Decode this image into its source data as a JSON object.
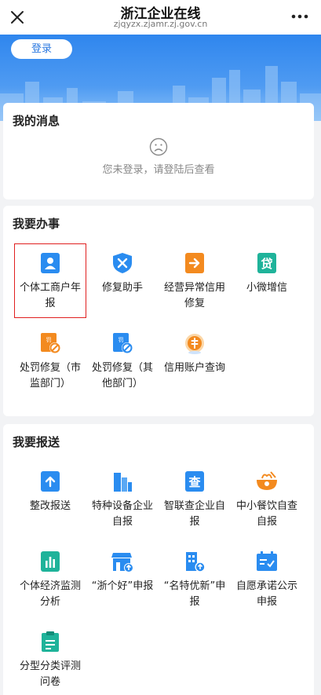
{
  "header": {
    "title": "浙江企业在线",
    "url": "zjqyzx.zjamr.zj.gov.cn"
  },
  "banner": {
    "login_label": "登录"
  },
  "messages": {
    "title": "我的消息",
    "empty_text": "您未登录，请登陆后查看"
  },
  "services": {
    "title": "我要办事",
    "items": [
      {
        "label": "个体工商户年报",
        "icon": "id-card-icon",
        "highlighted": true
      },
      {
        "label": "修复助手",
        "icon": "repair-shield-icon"
      },
      {
        "label": "经营异常信用修复",
        "icon": "arrow-doc-icon"
      },
      {
        "label": "小微增信",
        "icon": "loan-icon"
      },
      {
        "label": "处罚修复（市监部门）",
        "icon": "penalty-icon"
      },
      {
        "label": "处罚修复（其他部门）",
        "icon": "penalty-other-icon"
      },
      {
        "label": "信用账户查询",
        "icon": "coin-icon"
      }
    ]
  },
  "reports": {
    "title": "我要报送",
    "items": [
      {
        "label": "整改报送",
        "icon": "upload-doc-icon"
      },
      {
        "label": "特种设备企业自报",
        "icon": "building-icon"
      },
      {
        "label": "智联查企业自报",
        "icon": "search-doc-icon"
      },
      {
        "label": "中小餐饮自查自报",
        "icon": "food-bowl-icon"
      },
      {
        "label": "个体经济监测分析",
        "icon": "bar-chart-icon"
      },
      {
        "label": "“浙个好”申报",
        "icon": "shop-upload-icon"
      },
      {
        "label": "“名特优新”申报",
        "icon": "building-upload-icon"
      },
      {
        "label": "自愿承诺公示申报",
        "icon": "check-board-icon"
      },
      {
        "label": "分型分类评测问卷",
        "icon": "clipboard-icon"
      }
    ]
  },
  "colors": {
    "accent": "#2a8cf0",
    "highlight": "#e02020",
    "orange": "#f38a1f",
    "teal": "#1fb39a"
  }
}
